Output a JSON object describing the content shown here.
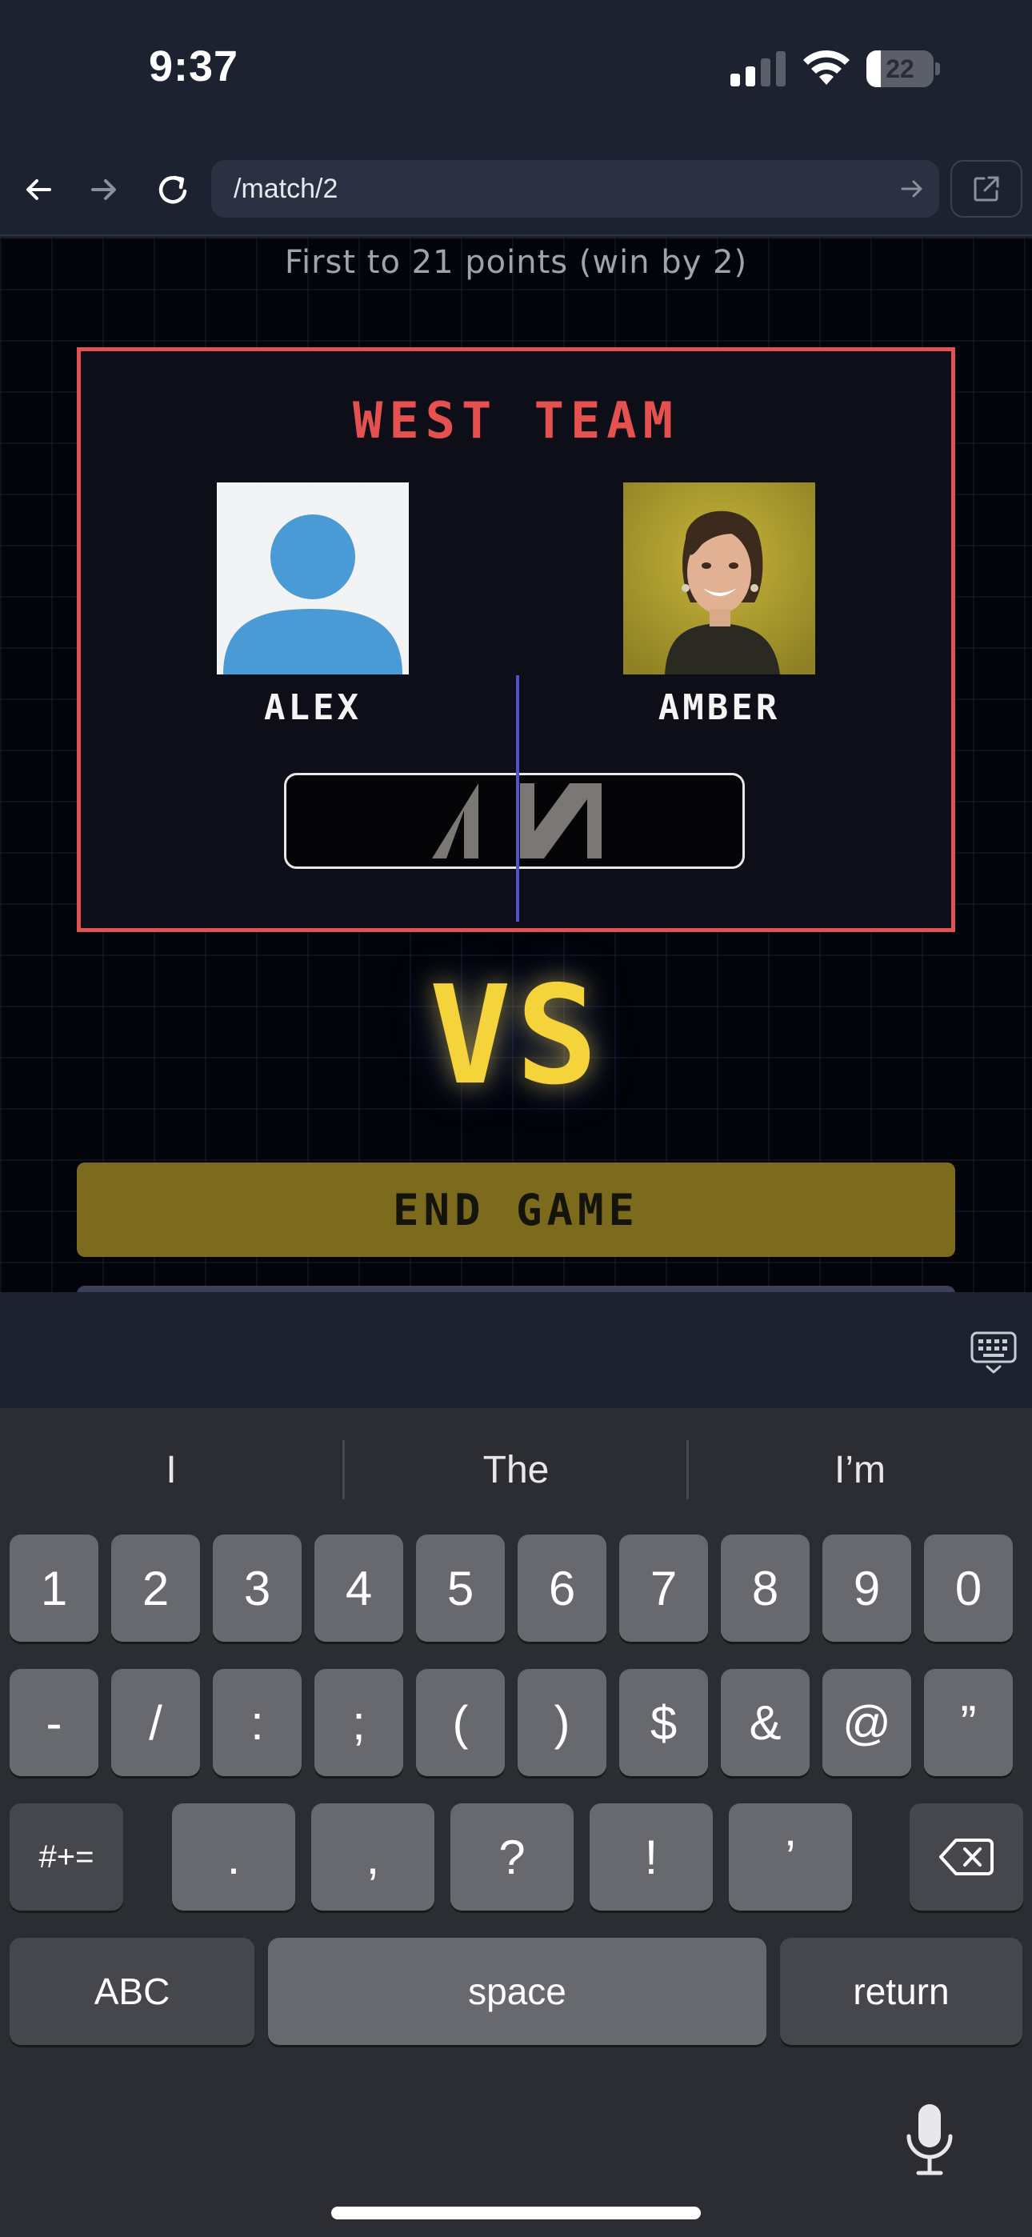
{
  "status_bar": {
    "time": "9:37",
    "battery_level": "22",
    "battery_fraction": 0.22,
    "icons": [
      "cellular-signal-icon",
      "wifi-icon",
      "battery-icon"
    ]
  },
  "browser": {
    "url": "/match/2",
    "icons": [
      "back-arrow-icon",
      "forward-arrow-icon",
      "reload-icon",
      "go-arrow-icon",
      "open-external-icon"
    ]
  },
  "match": {
    "rules": "First to 21 points (win by 2)",
    "team": {
      "name": "WEST TEAM",
      "color": "#e25252",
      "players": [
        {
          "name": "ALEX",
          "avatar": "default-avatar"
        },
        {
          "name": "AMBER",
          "avatar": "photo-avatar"
        }
      ]
    },
    "vs_label": "VS",
    "vs_color": "#f5d33a",
    "end_button": "END GAME",
    "end_button_color": "#7c6a1d"
  },
  "keyboard": {
    "suggestions": [
      "I",
      "The",
      "I’m"
    ],
    "row1": [
      "1",
      "2",
      "3",
      "4",
      "5",
      "6",
      "7",
      "8",
      "9",
      "0"
    ],
    "row2": [
      "-",
      "/",
      ":",
      ";",
      "(",
      ")",
      "$",
      "&",
      "@",
      "”"
    ],
    "row3": {
      "shift": "#+=",
      "keys": [
        ".",
        ",",
        "?",
        "!",
        "’"
      ],
      "delete_icon": "backspace-icon"
    },
    "row4": {
      "abc": "ABC",
      "space": "space",
      "return": "return"
    },
    "dismiss_icon": "keyboard-dismiss-icon",
    "mic_icon": "microphone-icon"
  }
}
